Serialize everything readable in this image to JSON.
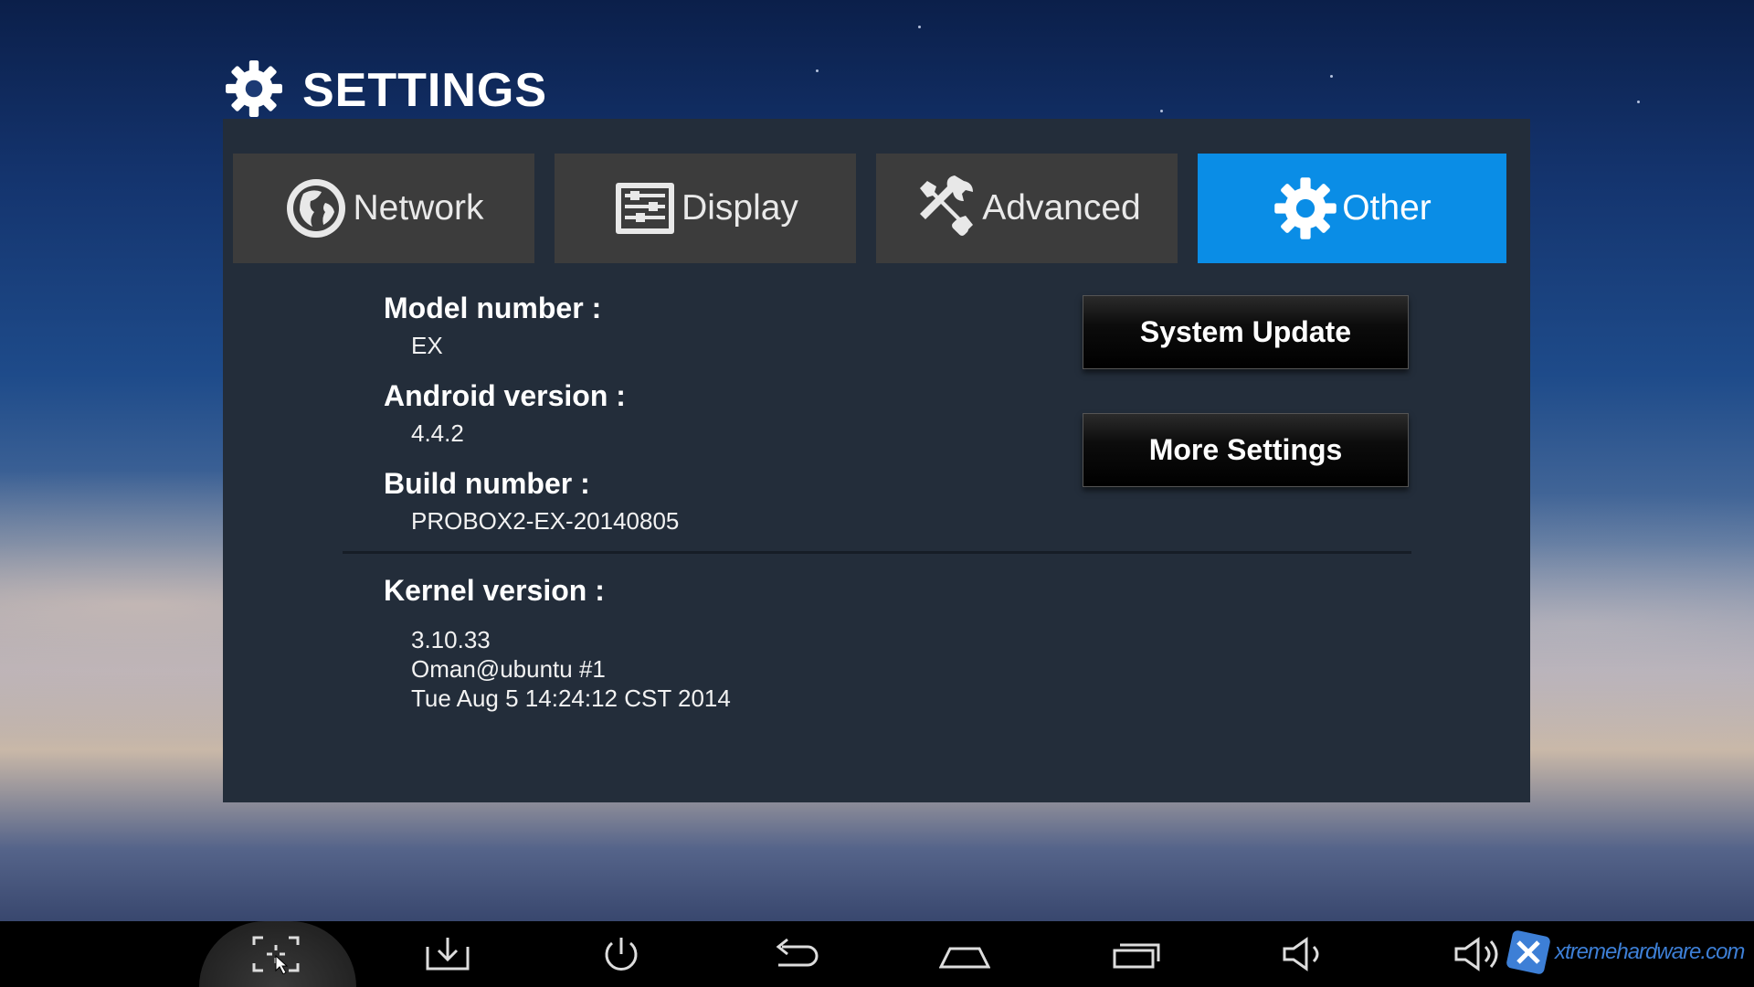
{
  "header": {
    "title": "SETTINGS",
    "icon": "gear-icon"
  },
  "tabs": [
    {
      "label": "Network",
      "icon": "globe-icon",
      "active": false
    },
    {
      "label": "Display",
      "icon": "display-settings-icon",
      "active": false
    },
    {
      "label": "Advanced",
      "icon": "tools-icon",
      "active": false
    },
    {
      "label": "Other",
      "icon": "gear-icon",
      "active": true
    }
  ],
  "info": {
    "model_label": "Model number :",
    "model_value": "EX",
    "android_label": "Android version :",
    "android_value": "4.4.2",
    "build_label": "Build number :",
    "build_value": "PROBOX2-EX-20140805",
    "kernel_label": "Kernel version :",
    "kernel_lines": [
      "3.10.33",
      "Oman@ubuntu #1",
      "Tue Aug 5 14:24:12 CST 2014"
    ]
  },
  "buttons": {
    "system_update": "System Update",
    "more_settings": "More Settings"
  },
  "navbar": {
    "icons": [
      "screenshot-icon",
      "download-icon",
      "power-icon",
      "back-icon",
      "home-icon",
      "recent-apps-icon",
      "volume-down-icon",
      "volume-up-icon"
    ]
  },
  "watermark": {
    "text": "xtremehardware.com"
  },
  "colors": {
    "panel": "#232d3a",
    "tab": "#3c3c3c",
    "tab_active": "#0a8de6",
    "watermark": "#3d7fd6"
  }
}
